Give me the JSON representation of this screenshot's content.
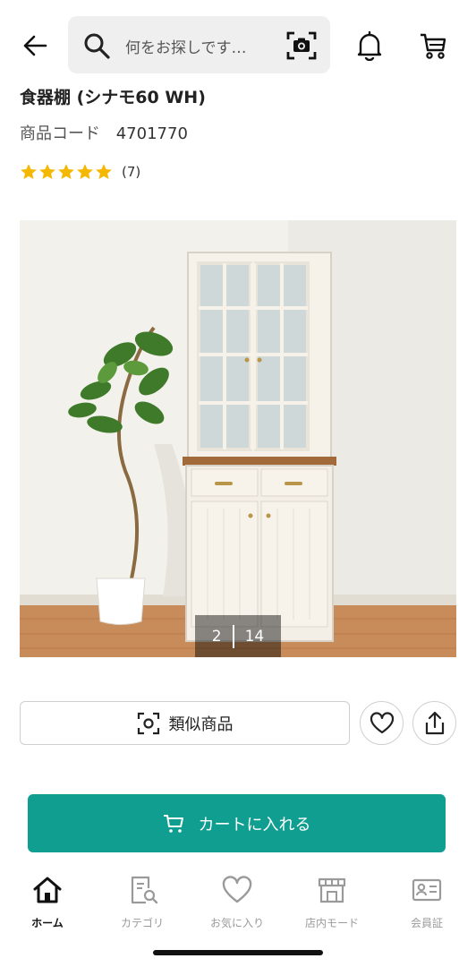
{
  "header": {
    "back_icon": "arrow-left-icon",
    "search_placeholder": "何をお探しです…",
    "search_icon": "search-icon",
    "camera_icon": "camera-scan-icon",
    "bell_icon": "bell-icon",
    "cart_icon": "cart-icon"
  },
  "product": {
    "title": "食器棚 (シナモ60 WH)",
    "code_label": "商品コード",
    "code_value": "4701770",
    "rating": 5,
    "rating_max": 5,
    "review_count": "(7)",
    "star_color": "#f5b800"
  },
  "gallery": {
    "current": "2",
    "total": "14"
  },
  "actions": {
    "similar_label": "類似商品",
    "favorite_icon": "heart-icon",
    "share_icon": "share-icon",
    "add_to_cart_label": "カートに入れる",
    "accent_color": "#0f9e90"
  },
  "bottom_nav": {
    "items": [
      {
        "label": "ホーム",
        "icon": "home-icon",
        "active": true
      },
      {
        "label": "カテゴリ",
        "icon": "category-search-icon",
        "active": false
      },
      {
        "label": "お気に入り",
        "icon": "heart-icon",
        "active": false
      },
      {
        "label": "店内モード",
        "icon": "store-icon",
        "active": false
      },
      {
        "label": "会員証",
        "icon": "member-card-icon",
        "active": false
      }
    ]
  }
}
